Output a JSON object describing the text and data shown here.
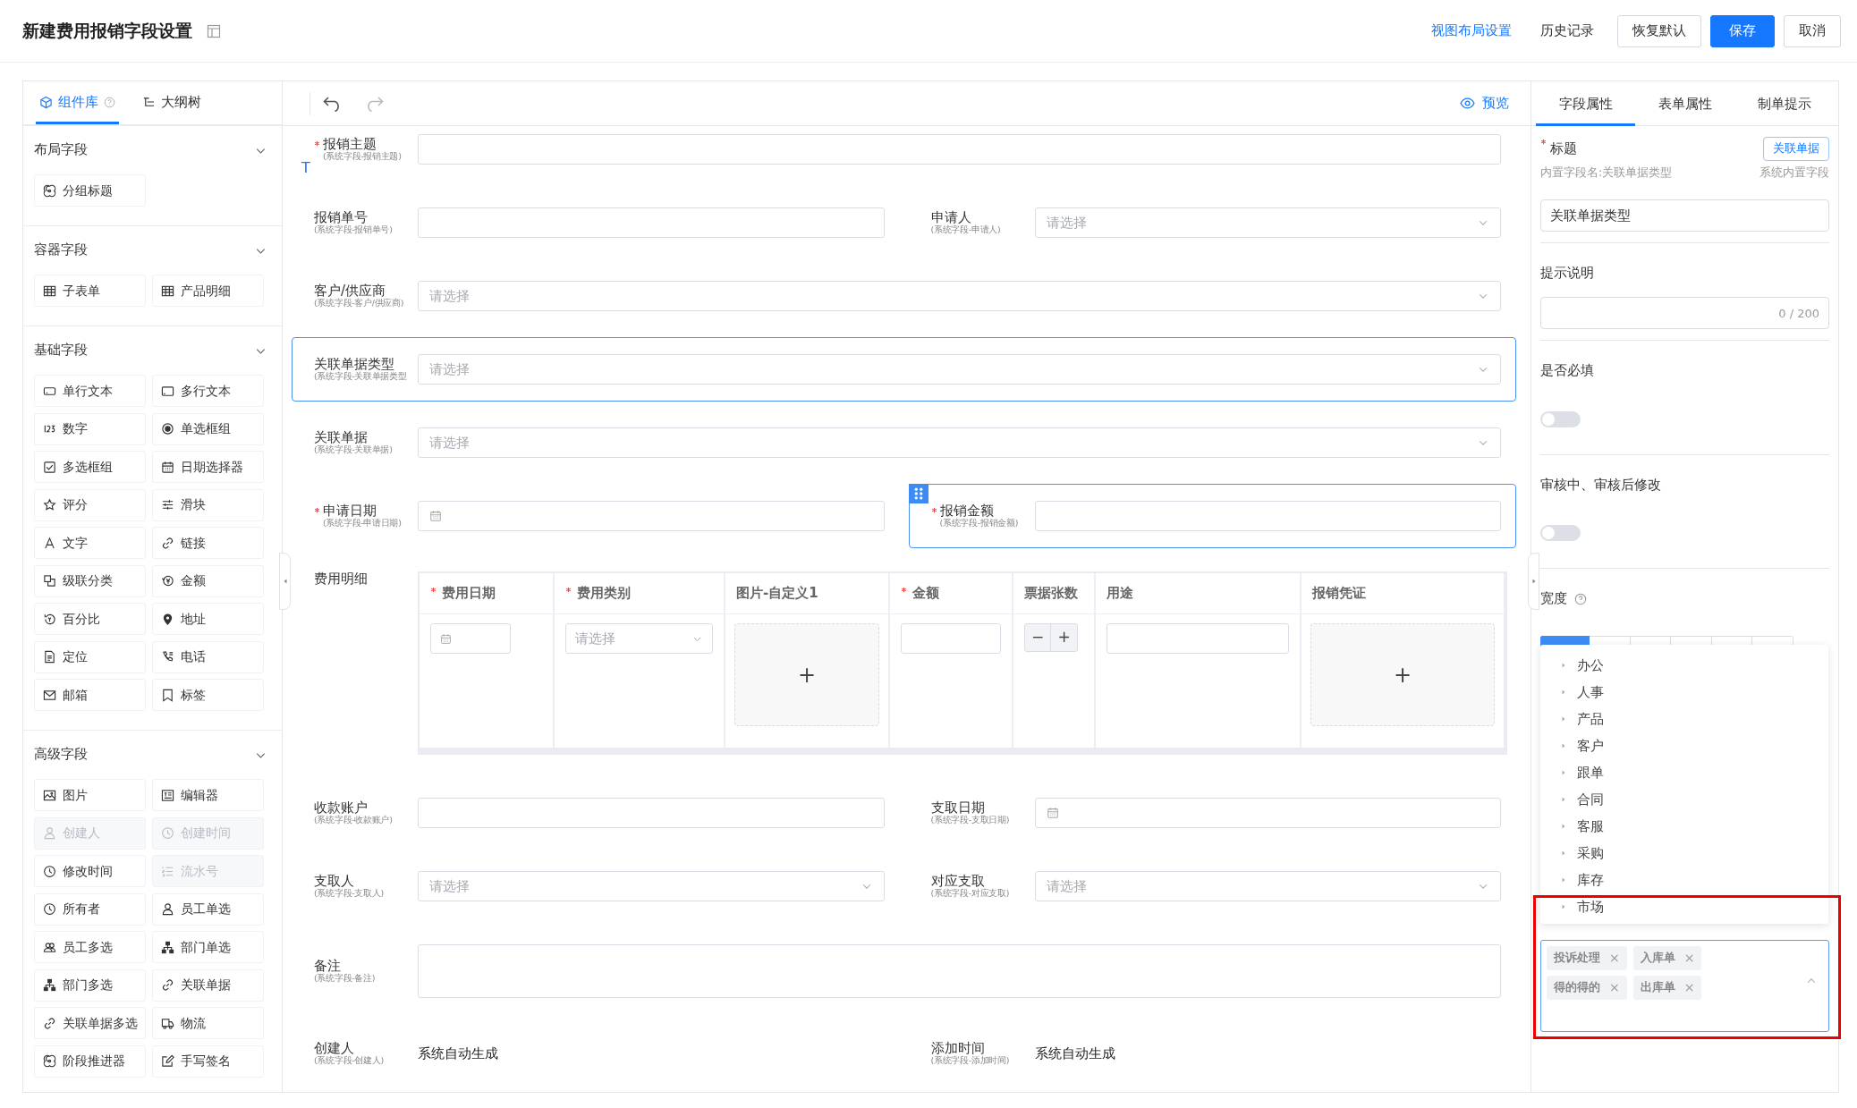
{
  "header": {
    "title": "新建费用报销字段设置",
    "actions": [
      {
        "label": "视图布局设置",
        "kind": "link"
      },
      {
        "label": "历史记录",
        "kind": "text"
      },
      {
        "label": "恢复默认",
        "kind": "outline"
      },
      {
        "label": "保存",
        "kind": "primary"
      },
      {
        "label": "取消",
        "kind": "outline"
      }
    ]
  },
  "components": {
    "tabs": [
      {
        "label": "组件库",
        "selected": true
      },
      {
        "label": "大纲树",
        "selected": false
      }
    ],
    "groups": [
      {
        "title": "布局字段",
        "expanded": true,
        "items": [
          {
            "label": "分组标题",
            "disabled": false
          }
        ]
      },
      {
        "title": "容器字段",
        "expanded": true,
        "items": [
          {
            "label": "子表单",
            "disabled": false
          },
          {
            "label": "产品明细",
            "disabled": false
          }
        ]
      },
      {
        "title": "基础字段",
        "expanded": true,
        "items": [
          {
            "label": "单行文本",
            "disabled": false
          },
          {
            "label": "多行文本",
            "disabled": false
          },
          {
            "label": "数字",
            "disabled": false
          },
          {
            "label": "单选框组",
            "disabled": false
          },
          {
            "label": "多选框组",
            "disabled": false
          },
          {
            "label": "日期选择器",
            "disabled": false
          },
          {
            "label": "评分",
            "disabled": false
          },
          {
            "label": "滑块",
            "disabled": false
          },
          {
            "label": "文字",
            "disabled": false
          },
          {
            "label": "链接",
            "disabled": false
          },
          {
            "label": "级联分类",
            "disabled": false
          },
          {
            "label": "金额",
            "disabled": false
          },
          {
            "label": "百分比",
            "disabled": false
          },
          {
            "label": "地址",
            "disabled": false
          },
          {
            "label": "定位",
            "disabled": false
          },
          {
            "label": "电话",
            "disabled": false
          },
          {
            "label": "邮箱",
            "disabled": false
          },
          {
            "label": "标签",
            "disabled": false
          }
        ]
      },
      {
        "title": "高级字段",
        "expanded": true,
        "items": [
          {
            "label": "图片",
            "disabled": false
          },
          {
            "label": "编辑器",
            "disabled": false
          },
          {
            "label": "创建人",
            "disabled": true
          },
          {
            "label": "创建时间",
            "disabled": true
          },
          {
            "label": "修改时间",
            "disabled": false
          },
          {
            "label": "流水号",
            "disabled": true
          },
          {
            "label": "所有者",
            "disabled": false
          },
          {
            "label": "员工单选",
            "disabled": false
          },
          {
            "label": "员工多选",
            "disabled": false
          },
          {
            "label": "部门单选",
            "disabled": false
          },
          {
            "label": "部门多选",
            "disabled": false
          },
          {
            "label": "关联单据",
            "disabled": false
          },
          {
            "label": "关联单据多选",
            "disabled": false
          },
          {
            "label": "物流",
            "disabled": false
          },
          {
            "label": "阶段推进器",
            "disabled": false
          },
          {
            "label": "手写签名",
            "disabled": false
          }
        ]
      }
    ]
  },
  "canvas": {
    "preview": "预览",
    "drop_marker": "T",
    "rows": [
      [
        {
          "label": "报销主题",
          "sub": "(系统字段-报销主题)",
          "required": true,
          "kind": "text",
          "selected": false
        }
      ],
      [
        {
          "label": "报销单号",
          "sub": "(系统字段-报销单号)",
          "required": false,
          "kind": "text",
          "selected": false
        },
        {
          "label": "申请人",
          "sub": "(系统字段-申请人)",
          "required": false,
          "kind": "select",
          "placeholder": "请选择",
          "selected": false
        }
      ],
      [
        {
          "label": "客户/供应商",
          "sub": "(系统字段-客户/供应商)",
          "required": false,
          "kind": "select",
          "placeholder": "请选择",
          "selected": false
        }
      ],
      [
        {
          "label": "关联单据类型",
          "sub": "(系统字段-关联单据类型",
          "required": false,
          "kind": "select",
          "placeholder": "请选择",
          "selected": true
        }
      ],
      [
        {
          "label": "关联单据",
          "sub": "(系统字段-关联单据)",
          "required": false,
          "kind": "select",
          "placeholder": "请选择",
          "selected": false
        }
      ],
      [
        {
          "label": "申请日期",
          "sub": "(系统字段-申请日期)",
          "required": true,
          "kind": "date",
          "selected": false
        },
        {
          "label": "报销金额",
          "sub": "(系统字段-报销金额)",
          "required": true,
          "kind": "text",
          "selected": true
        }
      ],
      [
        {
          "label": "费用明细",
          "required": false,
          "kind": "subtable",
          "selected": false,
          "columns": [
            {
              "label": "费用日期",
              "required": true,
              "kind": "date"
            },
            {
              "label": "费用类别",
              "required": true,
              "kind": "select",
              "placeholder": "请选择"
            },
            {
              "label": "图片-自定义1",
              "required": false,
              "kind": "upload",
              "plus": "+"
            },
            {
              "label": "金额",
              "required": true,
              "kind": "text"
            },
            {
              "label": "票据张数",
              "required": false,
              "kind": "stepper",
              "minus": "−",
              "plus": "+"
            },
            {
              "label": "用途",
              "required": false,
              "kind": "text"
            },
            {
              "label": "报销凭证",
              "required": false,
              "kind": "upload",
              "plus": "+"
            }
          ]
        }
      ],
      [
        {
          "label": "收款账户",
          "sub": "(系统字段-收款账户)",
          "required": false,
          "kind": "text",
          "selected": false
        },
        {
          "label": "支取日期",
          "sub": "(系统字段-支取日期)",
          "required": false,
          "kind": "date",
          "selected": false
        }
      ],
      [
        {
          "label": "支取人",
          "sub": "(系统字段-支取人)",
          "required": false,
          "kind": "select",
          "placeholder": "请选择",
          "selected": false
        },
        {
          "label": "对应支取",
          "sub": "(系统字段-对应支取)",
          "required": false,
          "kind": "select",
          "placeholder": "请选择",
          "selected": false
        }
      ],
      [
        {
          "label": "备注",
          "sub": "(系统字段-备注)",
          "required": false,
          "kind": "textarea",
          "selected": false
        }
      ],
      [
        {
          "label": "创建人",
          "sub": "(系统字段-创建人)",
          "required": false,
          "kind": "static",
          "value": "系统自动生成",
          "selected": false
        },
        {
          "label": "添加时间",
          "sub": "(系统字段-添加时间)",
          "required": false,
          "kind": "static",
          "value": "系统自动生成",
          "selected": false
        }
      ]
    ]
  },
  "properties": {
    "tabs": [
      {
        "label": "字段属性",
        "selected": true
      },
      {
        "label": "表单属性",
        "selected": false
      },
      {
        "label": "制单提示",
        "selected": false
      }
    ],
    "title": {
      "label": "标题",
      "required": true,
      "link_button": "关联单据",
      "builtin_name": "内置字段名:关联单据类型",
      "note": "系统内置字段",
      "value": "关联单据类型"
    },
    "hint": {
      "label": "提示说明",
      "counter": "0 / 200"
    },
    "switches": [
      {
        "label": "是否必填",
        "on": false
      },
      {
        "label": "审核中、审核后修改",
        "on": false
      }
    ],
    "width": {
      "label": "宽度",
      "options": [
        {
          "selected": true
        },
        {
          "selected": false
        },
        {
          "selected": false
        },
        {
          "selected": false
        },
        {
          "selected": false
        },
        {
          "selected": false
        }
      ]
    },
    "dropdown": [
      {
        "label": "办公",
        "expandable": true
      },
      {
        "label": "人事",
        "expandable": true
      },
      {
        "label": "产品",
        "expandable": true
      },
      {
        "label": "客户",
        "expandable": true
      },
      {
        "label": "跟单",
        "expandable": true
      },
      {
        "label": "合同",
        "expandable": true
      },
      {
        "label": "客服",
        "expandable": true
      },
      {
        "label": "采购",
        "expandable": true
      },
      {
        "label": "库存",
        "expandable": true
      },
      {
        "label": "市场",
        "expandable": true
      }
    ],
    "tags": [
      {
        "label": "投诉处理",
        "remove": "×"
      },
      {
        "label": "入库单",
        "remove": "×"
      },
      {
        "label": "得的得的",
        "remove": "×"
      },
      {
        "label": "出库单",
        "remove": "×"
      }
    ],
    "annotation": {
      "kind": "frame"
    }
  }
}
